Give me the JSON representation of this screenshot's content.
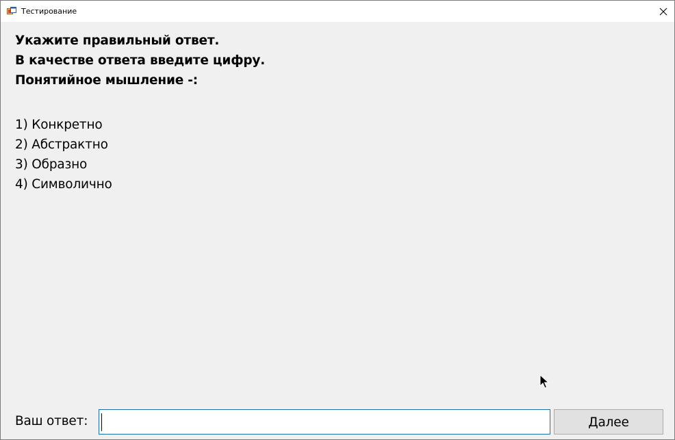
{
  "window": {
    "title": "Тестирование"
  },
  "question": {
    "lines": [
      "Укажите правильный ответ.",
      "В качестве ответа введите цифру.",
      "Понятийное мышление -:"
    ],
    "options": [
      "1) Конкретно",
      "2) Абстрактно",
      "3) Образно",
      "4) Символично"
    ]
  },
  "answer": {
    "label": "Ваш ответ:",
    "value": "",
    "next_label": "Далее"
  },
  "icons": {
    "app": "app-window-icon",
    "close": "close-icon",
    "pointer": "mouse-pointer-icon"
  }
}
